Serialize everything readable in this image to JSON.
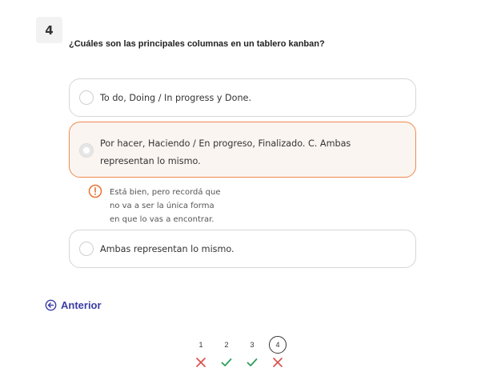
{
  "question": {
    "number": "4",
    "text": "¿Cuáles son las principales columnas en un tablero kanban?"
  },
  "options": [
    {
      "label": "To do, Doing / In progress y Done.",
      "state": "unselected"
    },
    {
      "label": "Por hacer, Haciendo / En progreso, Finalizado. C. Ambas representan lo mismo.",
      "state": "selected"
    },
    {
      "label": "Ambas representan lo mismo.",
      "state": "unselected"
    }
  ],
  "feedback": {
    "lines": [
      "Está bien, pero recordá que",
      "no va a ser la única forma",
      "en que lo vas a encontrar."
    ],
    "icon": "alert-circle-icon",
    "color": "#e8732f"
  },
  "navigation": {
    "back_label": "Anterior",
    "back_icon": "arrow-left-circle-icon",
    "color": "#3b3da6"
  },
  "progress": [
    {
      "number": "1",
      "result": "incorrect"
    },
    {
      "number": "2",
      "result": "correct"
    },
    {
      "number": "3",
      "result": "correct"
    },
    {
      "number": "4",
      "result": "incorrect",
      "current": true
    }
  ],
  "colors": {
    "correct": "#2e9e5b",
    "incorrect": "#d9534f",
    "selected_border": "#ef8a4e"
  }
}
